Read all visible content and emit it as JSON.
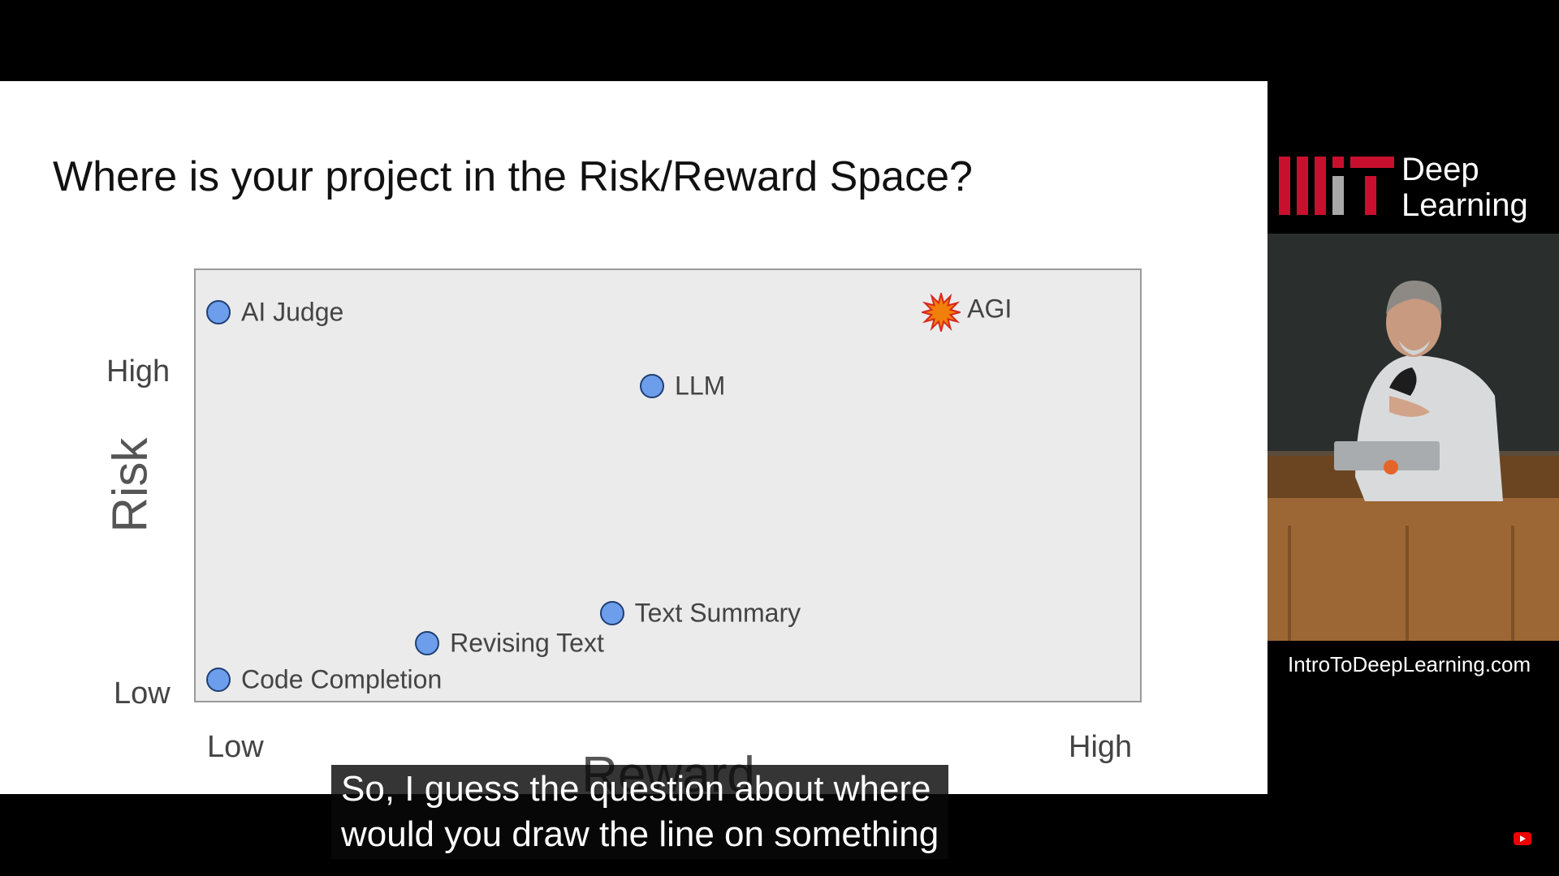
{
  "slide": {
    "title": "Where is your project in the Risk/Reward Space?"
  },
  "chart_data": {
    "type": "scatter",
    "xlabel": "Reward",
    "ylabel": "Risk",
    "x_ticks": [
      "Low",
      "High"
    ],
    "y_ticks": [
      "Low",
      "High"
    ],
    "xlim": [
      0,
      1
    ],
    "ylim": [
      0,
      1
    ],
    "points": [
      {
        "label": "AI Judge",
        "x": 0.0,
        "y": 1.0,
        "marker": "circle"
      },
      {
        "label": "AGI",
        "x": 0.9,
        "y": 1.0,
        "marker": "burst"
      },
      {
        "label": "LLM",
        "x": 0.54,
        "y": 0.8,
        "marker": "circle"
      },
      {
        "label": "Text Summary",
        "x": 0.49,
        "y": 0.18,
        "marker": "circle"
      },
      {
        "label": "Revising Text",
        "x": 0.26,
        "y": 0.1,
        "marker": "circle"
      },
      {
        "label": "Code Completion",
        "x": 0.0,
        "y": 0.0,
        "marker": "circle"
      }
    ],
    "colors": {
      "point_fill": "#6d9eeb",
      "point_stroke": "#1f3f73",
      "burst_fill": "#f07f0b",
      "burst_stroke": "#d7271c",
      "plot_bg": "#ebebeb"
    }
  },
  "logo": {
    "line1": "Deep",
    "line2": "Learning",
    "brand_color": "#c8102e"
  },
  "website": "IntroToDeepLearning.com",
  "captions": {
    "line1": "So, I guess the question about where",
    "line2": "would you draw the line on something"
  },
  "icons": {
    "youtube": "youtube-subscribe-icon"
  }
}
